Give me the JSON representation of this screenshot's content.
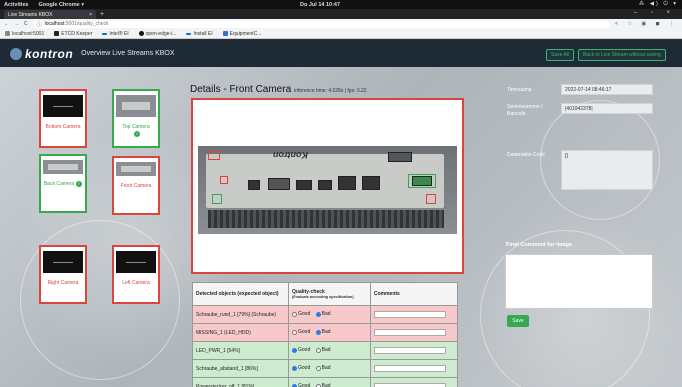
{
  "gnome": {
    "activities": "Activities",
    "app": "Google Chrome ▾",
    "clock": "Do Jul 14 10:47",
    "tray": "⁂ ◀) ⏻ ▾"
  },
  "browser": {
    "tab_title": "Live Streams KBOX",
    "tab_close": "×",
    "new_tab": "+",
    "window_controls": "‒ ▫ ×",
    "nav": {
      "back": "←",
      "forward": "→",
      "reload": "C"
    },
    "url_host": "localhost",
    "url_path": ":5001/quality_check",
    "toolbar_right": "< ☆ ▣ ◼ ⋮",
    "bookmarks": [
      {
        "label": "localhost:5001"
      },
      {
        "label": "ETCD Keeper"
      },
      {
        "label": "Intel® EI"
      },
      {
        "label": "open-edge-i..."
      },
      {
        "label": "Install EI"
      },
      {
        "label": "EquipmentC..."
      }
    ]
  },
  "header": {
    "logo_text": "kontron",
    "title": "Overview Live Streams KBOX",
    "save_all": "Save All",
    "back": "Back to Live Stream without saving"
  },
  "thumbnails": [
    {
      "label": "Bottom Camera",
      "status": "bad"
    },
    {
      "label": "Top Camera",
      "status": "good"
    },
    {
      "label": "Back Camera",
      "status": "good"
    },
    {
      "label": "Front Camera",
      "status": "bad"
    },
    {
      "label": "Right Camera",
      "status": "bad"
    },
    {
      "label": "Left Camera",
      "status": "bad"
    }
  ],
  "details": {
    "title": "Details - Front Camera",
    "info": "inference time: 4.528s | fps: 0.22",
    "image_label": "Kontron"
  },
  "right_panel": {
    "timestamp_label": "Timestamp",
    "timestamp_value": "2022-07-14 08:46:17",
    "serial_label": "Seriennummer / Barcode",
    "serial_value": "|401042378|",
    "datamatrix_label": "Datamatrix-Code",
    "datamatrix_value": "[]",
    "comment_label": "Final Comment for image",
    "save_button": "Save"
  },
  "table": {
    "col_object": "Detected objects (expected object)",
    "col_quality": "Quality-check",
    "col_quality_sub": "(Evaluate according specification)",
    "col_comments": "Comments",
    "good_label": "Good",
    "bad_label": "Bad",
    "rows": [
      {
        "object": "Schraube_rund_1 [79%] (Schraube)",
        "status": "bad"
      },
      {
        "object": "MISSING_1 (LED_HDD)",
        "status": "bad"
      },
      {
        "object": "LED_PWR_1 [54%]",
        "status": "good"
      },
      {
        "object": "Schraube_abstand_1 [86%]",
        "status": "good"
      },
      {
        "object": "Powerstecker_off_1 [81%]",
        "status": "good"
      }
    ]
  },
  "colors": {
    "good": "#38a94f",
    "bad": "#d9463d",
    "header_bg": "#1e2a35"
  }
}
